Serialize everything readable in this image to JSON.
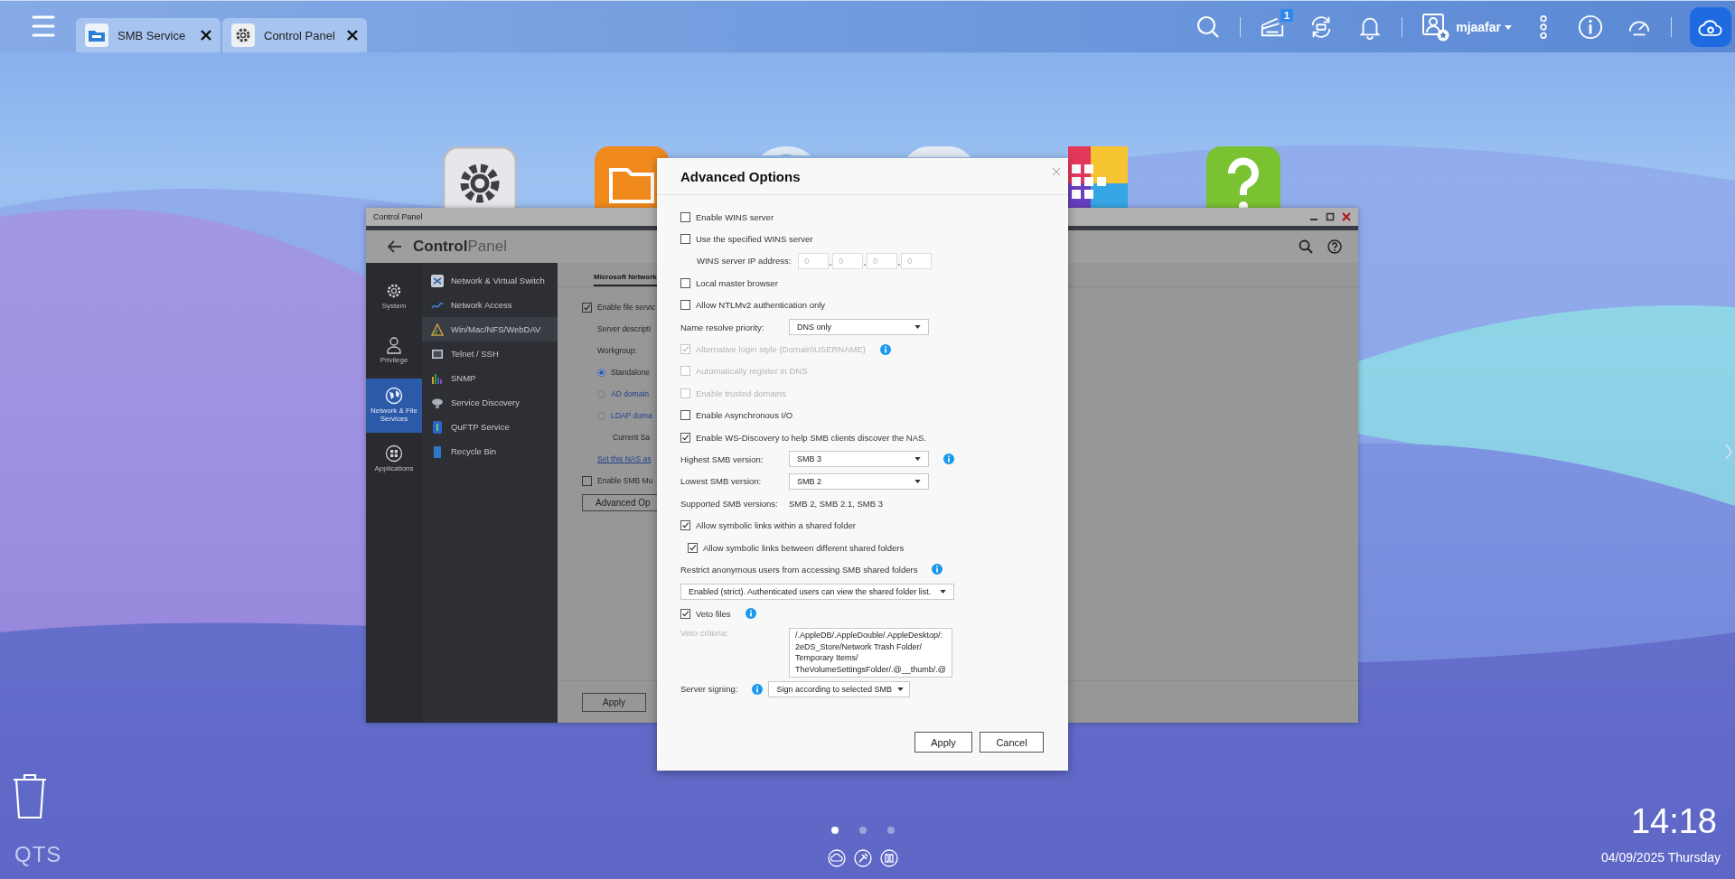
{
  "taskbar": {
    "tabs": [
      {
        "label": "SMB Service",
        "kind": "smb"
      },
      {
        "label": "Control Panel",
        "kind": "gear"
      }
    ],
    "notification_count": "1",
    "username": "mjaafar"
  },
  "desktop": {
    "page_dots": [
      {
        "selected": true
      },
      {
        "selected": false
      },
      {
        "selected": false
      }
    ],
    "logo": "QTS",
    "time": "14:18",
    "date": "04/09/2025 Thursday"
  },
  "control_panel": {
    "window_title": "Control Panel",
    "title_bold": "Control",
    "title_light": "Panel",
    "categories": [
      {
        "label": "System",
        "kind": "gear",
        "selected": false
      },
      {
        "label": "Privilege",
        "kind": "user",
        "selected": false
      },
      {
        "label": "Network & File Services",
        "kind": "globe",
        "selected": true
      },
      {
        "label": "Applications",
        "kind": "apps",
        "selected": false
      }
    ],
    "menu": [
      {
        "label": "Network & Virtual Switch",
        "kind": "switch",
        "selected": false
      },
      {
        "label": "Network Access",
        "kind": "access",
        "selected": false
      },
      {
        "label": "Win/Mac/NFS/WebDAV",
        "kind": "triangle",
        "selected": true
      },
      {
        "label": "Telnet / SSH",
        "kind": "terminal",
        "selected": false
      },
      {
        "label": "SNMP",
        "kind": "bars",
        "selected": false
      },
      {
        "label": "Service Discovery",
        "kind": "dish",
        "selected": false
      },
      {
        "label": "QuFTP Service",
        "kind": "ftp",
        "selected": false
      },
      {
        "label": "Recycle Bin",
        "kind": "bin",
        "selected": false
      }
    ],
    "tab": "Microsoft Network",
    "content": [
      {
        "kind": "checkbox",
        "label": "Enable file servic",
        "checked": true
      },
      {
        "kind": "text",
        "label": "Server descripti"
      },
      {
        "kind": "text",
        "label": "Workgroup:"
      },
      {
        "kind": "radio",
        "label": "Standalone",
        "selected": true
      },
      {
        "kind": "radio",
        "label": "AD domain",
        "selected": false
      },
      {
        "kind": "radio",
        "label": "LDAP doma",
        "selected": false
      },
      {
        "kind": "note",
        "label": "Current Sa"
      },
      {
        "kind": "link",
        "label": "Set this NAS as"
      },
      {
        "kind": "checkbox",
        "label": "Enable SMB Mu",
        "checked": false
      },
      {
        "kind": "button",
        "label": "Advanced Op"
      }
    ],
    "apply": "Apply"
  },
  "dialog": {
    "title": "Advanced Options",
    "items": [
      {
        "kind": "checkbox",
        "label": "Enable WINS server",
        "checked": false,
        "disabled": false
      },
      {
        "kind": "checkbox",
        "label": "Use the specified WINS server",
        "checked": false,
        "disabled": false
      },
      {
        "kind": "ip",
        "label": "WINS server IP address:",
        "octets": [
          "0",
          "0",
          "0",
          "0"
        ]
      },
      {
        "kind": "checkbox",
        "label": "Local master browser",
        "checked": false,
        "disabled": false
      },
      {
        "kind": "checkbox",
        "label": "Allow NTLMv2 authentication only",
        "checked": false,
        "disabled": false
      },
      {
        "kind": "select",
        "label": "Name resolve priority:",
        "value": "DNS only"
      },
      {
        "kind": "checkbox",
        "label": "Alternative login style (Domain\\USERNAME)",
        "checked": true,
        "disabled": true,
        "info": true
      },
      {
        "kind": "checkbox",
        "label": "Automatically register in DNS",
        "checked": false,
        "disabled": true
      },
      {
        "kind": "checkbox",
        "label": "Enable trusted domains",
        "checked": false,
        "disabled": true
      },
      {
        "kind": "checkbox",
        "label": "Enable Asynchronous I/O",
        "checked": false,
        "disabled": false
      },
      {
        "kind": "checkbox",
        "label": "Enable WS-Discovery to help SMB clients discover the NAS.",
        "checked": true,
        "disabled": false
      },
      {
        "kind": "select",
        "label": "Highest SMB version:",
        "value": "SMB 3",
        "info": true
      },
      {
        "kind": "select",
        "label": "Lowest SMB version:",
        "value": "SMB 2"
      },
      {
        "kind": "text",
        "label": "Supported SMB versions:",
        "value": "SMB 2, SMB 2.1, SMB 3"
      },
      {
        "kind": "checkbox",
        "label": "Allow symbolic links within a shared folder",
        "checked": true,
        "disabled": false
      },
      {
        "kind": "subcheckbox",
        "label": "Allow symbolic links between different shared folders",
        "checked": true,
        "disabled": false
      },
      {
        "kind": "heading",
        "label": "Restrict anonymous users from accessing SMB shared folders",
        "info": true
      },
      {
        "kind": "wideselect",
        "value": "Enabled (strict). Authenticated users can view the shared folder list."
      },
      {
        "kind": "checkbox",
        "label": "Veto files",
        "checked": true,
        "disabled": false,
        "info": true
      },
      {
        "kind": "textarea",
        "label": "Veto criteria:",
        "disabled": true,
        "lines": [
          "/.AppleDB/.AppleDouble/.AppleDesktop/:",
          "2eDS_Store/Network Trash Folder/",
          "Temporary Items/",
          "TheVolumeSettingsFolder/.@__thumb/.@"
        ]
      },
      {
        "kind": "signing",
        "label": "Server signing:",
        "value": "Sign according to selected SMB",
        "info": true
      }
    ],
    "buttons": [
      "Apply",
      "Cancel"
    ]
  }
}
